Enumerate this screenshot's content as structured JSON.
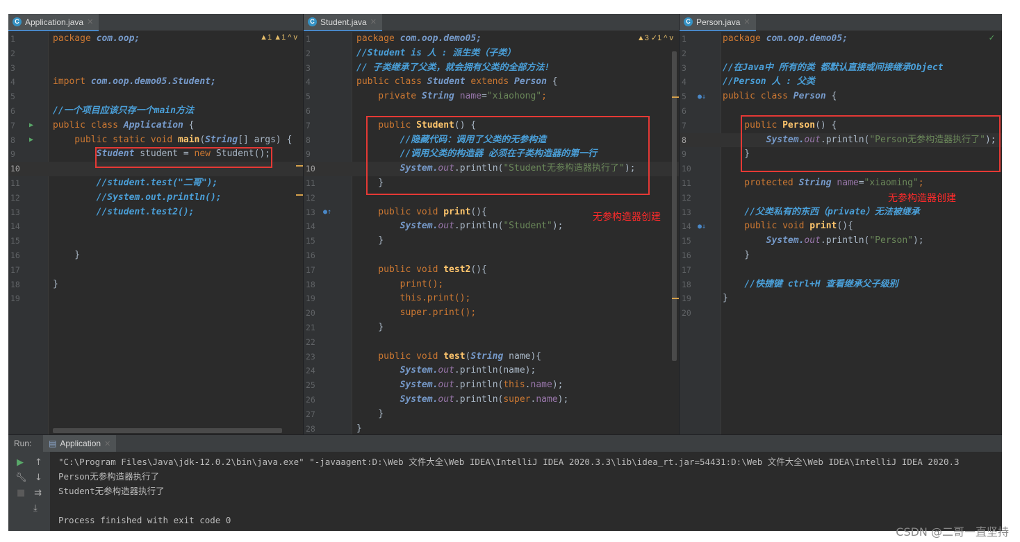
{
  "tabs": {
    "app": "Application.java",
    "student": "Student.java",
    "person": "Person.java"
  },
  "warnings": {
    "app": "▲1 ▲1 ^ v",
    "student": "▲3 ✓1 ^ v",
    "person": "✓"
  },
  "annotations": {
    "student_note": "无参构造器创建",
    "person_note": "无参构造器创建"
  },
  "run": {
    "label": "Run:",
    "tab": "Application",
    "lines": [
      "\"C:\\Program Files\\Java\\jdk-12.0.2\\bin\\java.exe\" \"-javaagent:D:\\Web 文件大全\\Web IDEA\\IntelliJ IDEA 2020.3.3\\lib\\idea_rt.jar=54431:D:\\Web 文件大全\\Web IDEA\\IntelliJ IDEA 2020.3",
      "Person无参构造器执行了",
      "Student无参构造器执行了",
      "",
      "Process finished with exit code 0"
    ]
  },
  "watermark": "CSDN @二哥一直坚持",
  "code": {
    "app": [
      [
        {
          "t": "package ",
          "c": "kw"
        },
        {
          "t": "com.oop;",
          "c": "cls"
        }
      ],
      [],
      [],
      [
        {
          "t": "import ",
          "c": "kw"
        },
        {
          "t": "com.oop.demo05.Student;",
          "c": "cls"
        }
      ],
      [],
      [
        {
          "t": "//一个项目应该只存一个main方法",
          "c": "cmtb"
        }
      ],
      [
        {
          "t": "public class ",
          "c": "kw"
        },
        {
          "t": "Application",
          "c": "cls"
        },
        {
          "t": " {"
        }
      ],
      [
        {
          "t": "    public static void ",
          "c": "kw"
        },
        {
          "t": "main",
          "c": "fn"
        },
        {
          "t": "("
        },
        {
          "t": "String",
          "c": "cls"
        },
        {
          "t": "[] args) {"
        }
      ],
      [
        {
          "t": "        "
        },
        {
          "t": "Student",
          "c": "cls"
        },
        {
          "t": " student = "
        },
        {
          "t": "new ",
          "c": "kw"
        },
        {
          "t": "Student();"
        }
      ],
      [],
      [
        {
          "t": "        "
        },
        {
          "t": "//student.test(\"二哥\");",
          "c": "cmtb"
        }
      ],
      [
        {
          "t": "        "
        },
        {
          "t": "//System.out.println();",
          "c": "cmtb"
        }
      ],
      [
        {
          "t": "        "
        },
        {
          "t": "//student.test2();",
          "c": "cmtb"
        }
      ],
      [],
      [],
      [
        {
          "t": "    }"
        }
      ],
      [],
      [
        {
          "t": "}"
        }
      ],
      []
    ],
    "student": [
      [
        {
          "t": "package ",
          "c": "kw"
        },
        {
          "t": "com.oop.demo05;",
          "c": "cls"
        }
      ],
      [
        {
          "t": "//Student is 人 : 派生类（子类）",
          "c": "cmtb"
        }
      ],
      [
        {
          "t": "// 子类继承了父类，就会拥有父类的全部方法!",
          "c": "cmtb"
        }
      ],
      [
        {
          "t": "public class ",
          "c": "kw"
        },
        {
          "t": "Student",
          "c": "cls"
        },
        {
          "t": " extends ",
          "c": "kw"
        },
        {
          "t": "Person",
          "c": "cls"
        },
        {
          "t": " {"
        }
      ],
      [
        {
          "t": "    private ",
          "c": "kw"
        },
        {
          "t": "String ",
          "c": "cls"
        },
        {
          "t": "name",
          "c": "fld"
        },
        {
          "t": "="
        },
        {
          "t": "\"xiaohong\"",
          "c": "str"
        },
        {
          "t": ";",
          "c": "kw"
        }
      ],
      [],
      [
        {
          "t": "    public ",
          "c": "kw"
        },
        {
          "t": "Student",
          "c": "fn"
        },
        {
          "t": "() {"
        }
      ],
      [
        {
          "t": "        "
        },
        {
          "t": "//隐藏代码：调用了父类的无参构造",
          "c": "cmtb"
        }
      ],
      [
        {
          "t": "        "
        },
        {
          "t": "//调用父类的构造器 必须在子类构造器的第一行",
          "c": "cmtb"
        }
      ],
      [
        {
          "t": "        "
        },
        {
          "t": "System.",
          "c": "cls"
        },
        {
          "t": "out",
          "c": "st"
        },
        {
          "t": ".println("
        },
        {
          "t": "\"Student无参构造器执行了\"",
          "c": "str"
        },
        {
          "t": ");"
        }
      ],
      [
        {
          "t": "    }"
        }
      ],
      [],
      [
        {
          "t": "    public void ",
          "c": "kw"
        },
        {
          "t": "print",
          "c": "fn"
        },
        {
          "t": "(){"
        }
      ],
      [
        {
          "t": "        "
        },
        {
          "t": "System.",
          "c": "cls"
        },
        {
          "t": "out",
          "c": "st"
        },
        {
          "t": ".println("
        },
        {
          "t": "\"Student\"",
          "c": "str"
        },
        {
          "t": ");"
        }
      ],
      [
        {
          "t": "    }"
        }
      ],
      [],
      [
        {
          "t": "    public void ",
          "c": "kw"
        },
        {
          "t": "test2",
          "c": "fn"
        },
        {
          "t": "(){"
        }
      ],
      [
        {
          "t": "        print();",
          "c": "kw"
        }
      ],
      [
        {
          "t": "        this",
          "c": "kw"
        },
        {
          "t": ".print();",
          "c": "kw"
        }
      ],
      [
        {
          "t": "        super",
          "c": "kw"
        },
        {
          "t": ".print();",
          "c": "kw"
        }
      ],
      [
        {
          "t": "    }"
        }
      ],
      [],
      [
        {
          "t": "    public void ",
          "c": "kw"
        },
        {
          "t": "test",
          "c": "fn"
        },
        {
          "t": "("
        },
        {
          "t": "String",
          "c": "cls"
        },
        {
          "t": " name){"
        }
      ],
      [
        {
          "t": "        "
        },
        {
          "t": "System.",
          "c": "cls"
        },
        {
          "t": "out",
          "c": "st"
        },
        {
          "t": ".println(name);"
        }
      ],
      [
        {
          "t": "        "
        },
        {
          "t": "System.",
          "c": "cls"
        },
        {
          "t": "out",
          "c": "st"
        },
        {
          "t": ".println("
        },
        {
          "t": "this",
          "c": "kw"
        },
        {
          "t": "."
        },
        {
          "t": "name",
          "c": "fld"
        },
        {
          "t": ");"
        }
      ],
      [
        {
          "t": "        "
        },
        {
          "t": "System.",
          "c": "cls"
        },
        {
          "t": "out",
          "c": "st"
        },
        {
          "t": ".println("
        },
        {
          "t": "super",
          "c": "kw"
        },
        {
          "t": "."
        },
        {
          "t": "name",
          "c": "fld"
        },
        {
          "t": ");"
        }
      ],
      [
        {
          "t": "    }"
        }
      ],
      [
        {
          "t": "}"
        }
      ]
    ],
    "person": [
      [
        {
          "t": "package ",
          "c": "kw"
        },
        {
          "t": "com.oop.demo05;",
          "c": "cls"
        }
      ],
      [],
      [
        {
          "t": "//在Java中 所有的类 都默认直接或间接继承Object",
          "c": "cmtb"
        }
      ],
      [
        {
          "t": "//Person 人 : 父类",
          "c": "cmtb"
        }
      ],
      [
        {
          "t": "public class ",
          "c": "kw"
        },
        {
          "t": "Person",
          "c": "cls"
        },
        {
          "t": " {"
        }
      ],
      [],
      [
        {
          "t": "    public ",
          "c": "kw"
        },
        {
          "t": "Person",
          "c": "fn"
        },
        {
          "t": "() {"
        }
      ],
      [
        {
          "t": "        "
        },
        {
          "t": "System.",
          "c": "cls"
        },
        {
          "t": "out",
          "c": "st"
        },
        {
          "t": ".println("
        },
        {
          "t": "\"Person无参构造器执行了\"",
          "c": "str"
        },
        {
          "t": ");"
        }
      ],
      [
        {
          "t": "    }"
        }
      ],
      [],
      [
        {
          "t": "    protected ",
          "c": "kw"
        },
        {
          "t": "String ",
          "c": "cls"
        },
        {
          "t": "name",
          "c": "fld"
        },
        {
          "t": "="
        },
        {
          "t": "\"xiaoming\"",
          "c": "str"
        },
        {
          "t": ";",
          "c": "kw"
        }
      ],
      [],
      [
        {
          "t": "    "
        },
        {
          "t": "//父类私有的东西（private）无法被继承",
          "c": "cmtb"
        }
      ],
      [
        {
          "t": "    public void ",
          "c": "kw"
        },
        {
          "t": "print",
          "c": "fn"
        },
        {
          "t": "(){"
        }
      ],
      [
        {
          "t": "        "
        },
        {
          "t": "System.",
          "c": "cls"
        },
        {
          "t": "out",
          "c": "st"
        },
        {
          "t": ".println("
        },
        {
          "t": "\"Person\"",
          "c": "str"
        },
        {
          "t": ");"
        }
      ],
      [
        {
          "t": "    }"
        }
      ],
      [],
      [
        {
          "t": "    "
        },
        {
          "t": "//快捷键 ctrl+H 查看继承父子级别",
          "c": "cmtb"
        }
      ],
      [
        {
          "t": "}"
        }
      ],
      []
    ]
  }
}
